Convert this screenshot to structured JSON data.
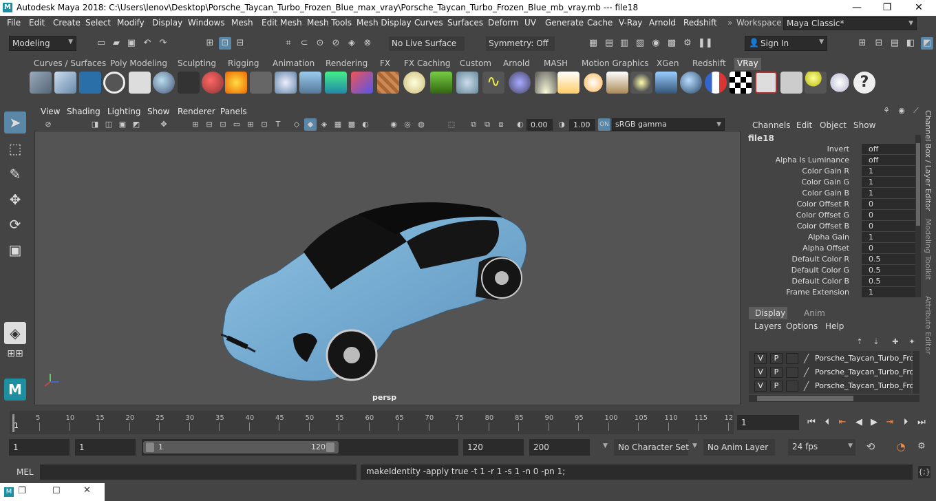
{
  "window": {
    "title": "Autodesk Maya 2018: C:\\Users\\lenov\\Desktop\\Porsche_Taycan_Turbo_Frozen_Blue_max_vray\\Porsche_Taycan_Turbo_Frozen_Blue_mb_vray.mb   ---   file18",
    "min": "—",
    "max": "❐",
    "close": "✕"
  },
  "menu": [
    "File",
    "Edit",
    "Create",
    "Select",
    "Modify",
    "Display",
    "Windows",
    "Mesh",
    "Edit Mesh",
    "Mesh Tools",
    "Mesh Display",
    "Curves",
    "Surfaces",
    "Deform",
    "UV",
    "Generate",
    "Cache",
    "V-Ray",
    "Arnold",
    "Redshift"
  ],
  "workspace": {
    "label": "Workspace :",
    "value": "Maya Classic*"
  },
  "statusline": {
    "mode": "Modeling",
    "live_surface": "No Live Surface",
    "symmetry": "Symmetry: Off",
    "sign_in": "Sign In"
  },
  "shelf_tabs": [
    "Curves / Surfaces",
    "Poly Modeling",
    "Sculpting",
    "Rigging",
    "Animation",
    "Rendering",
    "FX",
    "FX Caching",
    "Custom",
    "Arnold",
    "MASH",
    "Motion Graphics",
    "XGen",
    "Redshift",
    "VRay"
  ],
  "shelf_active": "VRay",
  "viewport": {
    "menu": [
      "View",
      "Shading",
      "Lighting",
      "Show",
      "Renderer",
      "Panels"
    ],
    "exposure": "0.00",
    "gamma": "1.00",
    "colorspace": "sRGB gamma",
    "camera": "persp"
  },
  "channelbox": {
    "menu": [
      "Channels",
      "Edit",
      "Object",
      "Show"
    ],
    "node": "file18",
    "attrs": [
      {
        "label": "Invert",
        "value": "off"
      },
      {
        "label": "Alpha Is Luminance",
        "value": "off"
      },
      {
        "label": "Color Gain R",
        "value": "1"
      },
      {
        "label": "Color Gain G",
        "value": "1"
      },
      {
        "label": "Color Gain B",
        "value": "1"
      },
      {
        "label": "Color Offset R",
        "value": "0"
      },
      {
        "label": "Color Offset G",
        "value": "0"
      },
      {
        "label": "Color Offset B",
        "value": "0"
      },
      {
        "label": "Alpha Gain",
        "value": "1"
      },
      {
        "label": "Alpha Offset",
        "value": "0"
      },
      {
        "label": "Default Color R",
        "value": "0.5"
      },
      {
        "label": "Default Color G",
        "value": "0.5"
      },
      {
        "label": "Default Color B",
        "value": "0.5"
      },
      {
        "label": "Frame Extension",
        "value": "1"
      }
    ]
  },
  "side_tabs": [
    "Channel Box / Layer Editor",
    "Modeling Toolkit",
    "Attribute Editor"
  ],
  "layer_editor": {
    "tabs": [
      "Display",
      "Anim"
    ],
    "menu": [
      "Layers",
      "Options",
      "Help"
    ],
    "rows": [
      {
        "v": "V",
        "p": "P",
        "name": "Porsche_Taycan_Turbo_Froz"
      },
      {
        "v": "V",
        "p": "P",
        "name": "Porsche_Taycan_Turbo_Froz"
      },
      {
        "v": "V",
        "p": "P",
        "name": "Porsche_Taycan_Turbo_Froz"
      }
    ]
  },
  "timeline": {
    "ticks": [
      "5",
      "10",
      "15",
      "20",
      "25",
      "30",
      "35",
      "40",
      "45",
      "50",
      "55",
      "60",
      "65",
      "70",
      "75",
      "80",
      "85",
      "90",
      "95",
      "100",
      "105",
      "110",
      "115",
      "12"
    ],
    "first": "1",
    "current_frame": "1"
  },
  "range": {
    "start": "1",
    "playback_start": "1",
    "slider_start": "1",
    "slider_end": "120",
    "playback_end": "120",
    "end": "200",
    "character_set": "No Character Set",
    "anim_layer": "No Anim Layer",
    "fps": "24 fps"
  },
  "command": {
    "lang": "MEL",
    "result": "makeIdentity -apply true -t 1 -r 1 -s 1 -n 0 -pn 1;"
  }
}
